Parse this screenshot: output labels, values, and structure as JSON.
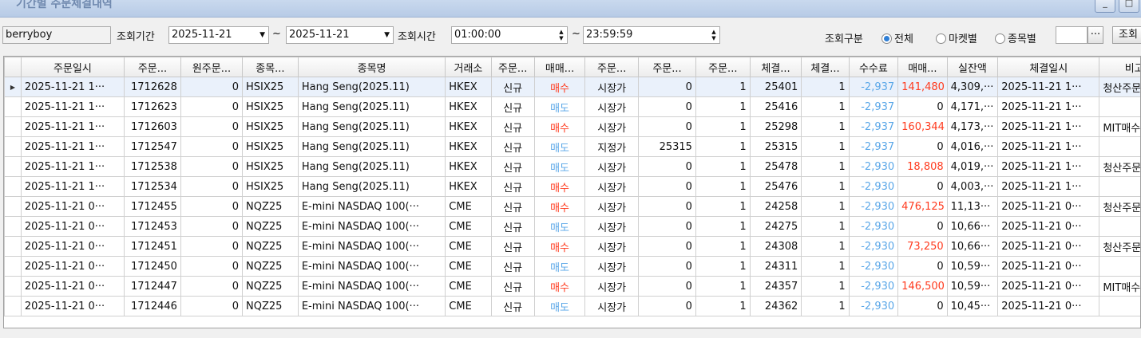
{
  "window": {
    "title": "기간별 주문체결내역",
    "minimize": "_",
    "maximize": "□"
  },
  "filters": {
    "account": "berryboy",
    "period_label": "조회기간",
    "date_from": "2025-11-21",
    "tilde1": "~",
    "date_to": "2025-11-21",
    "time_label": "조회시간",
    "time_from": "01:00:00",
    "tilde2": "~",
    "time_to": "23:59:59",
    "type_label": "조회구분",
    "radio_all": "전체",
    "radio_market": "마켓별",
    "radio_symbol": "종목별",
    "more_button": "···",
    "query_button": "조회"
  },
  "columns": [
    "주문일시",
    "주문...",
    "원주문...",
    "종목...",
    "종목명",
    "거래소",
    "주문...",
    "매매...",
    "주문...",
    "주문...",
    "주문...",
    "체결...",
    "체결...",
    "수수료",
    "매매...",
    "실잔액",
    "체결일시",
    "비고"
  ],
  "rows": [
    {
      "order_time": "2025-11-21 1···",
      "order_no": "1712628",
      "orig_no": "0",
      "code": "HSIX25",
      "name": "Hang Seng(2025.11)",
      "exch": "HKEX",
      "otype": "신규",
      "side": "매수",
      "ptype": "시장가",
      "oprice": "0",
      "oqty": "1",
      "fprice": "25401",
      "fqty": "1",
      "fee": "-2,937",
      "pnl": "141,480",
      "bal": "4,309,···",
      "ftime": "2025-11-21 1···",
      "note": "청산주문"
    },
    {
      "order_time": "2025-11-21 1···",
      "order_no": "1712623",
      "orig_no": "0",
      "code": "HSIX25",
      "name": "Hang Seng(2025.11)",
      "exch": "HKEX",
      "otype": "신규",
      "side": "매도",
      "ptype": "시장가",
      "oprice": "0",
      "oqty": "1",
      "fprice": "25416",
      "fqty": "1",
      "fee": "-2,937",
      "pnl": "0",
      "bal": "4,171,···",
      "ftime": "2025-11-21 1···",
      "note": ""
    },
    {
      "order_time": "2025-11-21 1···",
      "order_no": "1712603",
      "orig_no": "0",
      "code": "HSIX25",
      "name": "Hang Seng(2025.11)",
      "exch": "HKEX",
      "otype": "신규",
      "side": "매수",
      "ptype": "시장가",
      "oprice": "0",
      "oqty": "1",
      "fprice": "25298",
      "fqty": "1",
      "fee": "-2,937",
      "pnl": "160,344",
      "bal": "4,173,···",
      "ftime": "2025-11-21 1···",
      "note": "MIT매수"
    },
    {
      "order_time": "2025-11-21 1···",
      "order_no": "1712547",
      "orig_no": "0",
      "code": "HSIX25",
      "name": "Hang Seng(2025.11)",
      "exch": "HKEX",
      "otype": "신규",
      "side": "매도",
      "ptype": "지정가",
      "oprice": "25315",
      "oqty": "1",
      "fprice": "25315",
      "fqty": "1",
      "fee": "-2,937",
      "pnl": "0",
      "bal": "4,016,···",
      "ftime": "2025-11-21 1···",
      "note": ""
    },
    {
      "order_time": "2025-11-21 1···",
      "order_no": "1712538",
      "orig_no": "0",
      "code": "HSIX25",
      "name": "Hang Seng(2025.11)",
      "exch": "HKEX",
      "otype": "신규",
      "side": "매도",
      "ptype": "시장가",
      "oprice": "0",
      "oqty": "1",
      "fprice": "25478",
      "fqty": "1",
      "fee": "-2,930",
      "pnl": "18,808",
      "bal": "4,019,···",
      "ftime": "2025-11-21 1···",
      "note": "청산주문"
    },
    {
      "order_time": "2025-11-21 1···",
      "order_no": "1712534",
      "orig_no": "0",
      "code": "HSIX25",
      "name": "Hang Seng(2025.11)",
      "exch": "HKEX",
      "otype": "신규",
      "side": "매수",
      "ptype": "시장가",
      "oprice": "0",
      "oqty": "1",
      "fprice": "25476",
      "fqty": "1",
      "fee": "-2,930",
      "pnl": "0",
      "bal": "4,003,···",
      "ftime": "2025-11-21 1···",
      "note": ""
    },
    {
      "order_time": "2025-11-21 0···",
      "order_no": "1712455",
      "orig_no": "0",
      "code": "NQZ25",
      "name": "E-mini NASDAQ 100(···",
      "exch": "CME",
      "otype": "신규",
      "side": "매수",
      "ptype": "시장가",
      "oprice": "0",
      "oqty": "1",
      "fprice": "24258",
      "fqty": "1",
      "fee": "-2,930",
      "pnl": "476,125",
      "bal": "11,13···",
      "ftime": "2025-11-21 0···",
      "note": "청산주문"
    },
    {
      "order_time": "2025-11-21 0···",
      "order_no": "1712453",
      "orig_no": "0",
      "code": "NQZ25",
      "name": "E-mini NASDAQ 100(···",
      "exch": "CME",
      "otype": "신규",
      "side": "매도",
      "ptype": "시장가",
      "oprice": "0",
      "oqty": "1",
      "fprice": "24275",
      "fqty": "1",
      "fee": "-2,930",
      "pnl": "0",
      "bal": "10,66···",
      "ftime": "2025-11-21 0···",
      "note": ""
    },
    {
      "order_time": "2025-11-21 0···",
      "order_no": "1712451",
      "orig_no": "0",
      "code": "NQZ25",
      "name": "E-mini NASDAQ 100(···",
      "exch": "CME",
      "otype": "신규",
      "side": "매수",
      "ptype": "시장가",
      "oprice": "0",
      "oqty": "1",
      "fprice": "24308",
      "fqty": "1",
      "fee": "-2,930",
      "pnl": "73,250",
      "bal": "10,66···",
      "ftime": "2025-11-21 0···",
      "note": "청산주문"
    },
    {
      "order_time": "2025-11-21 0···",
      "order_no": "1712450",
      "orig_no": "0",
      "code": "NQZ25",
      "name": "E-mini NASDAQ 100(···",
      "exch": "CME",
      "otype": "신규",
      "side": "매도",
      "ptype": "시장가",
      "oprice": "0",
      "oqty": "1",
      "fprice": "24311",
      "fqty": "1",
      "fee": "-2,930",
      "pnl": "0",
      "bal": "10,59···",
      "ftime": "2025-11-21 0···",
      "note": ""
    },
    {
      "order_time": "2025-11-21 0···",
      "order_no": "1712447",
      "orig_no": "0",
      "code": "NQZ25",
      "name": "E-mini NASDAQ 100(···",
      "exch": "CME",
      "otype": "신규",
      "side": "매수",
      "ptype": "시장가",
      "oprice": "0",
      "oqty": "1",
      "fprice": "24357",
      "fqty": "1",
      "fee": "-2,930",
      "pnl": "146,500",
      "bal": "10,59···",
      "ftime": "2025-11-21 0···",
      "note": "MIT매수"
    },
    {
      "order_time": "2025-11-21 0···",
      "order_no": "1712446",
      "orig_no": "0",
      "code": "NQZ25",
      "name": "E-mini NASDAQ 100(···",
      "exch": "CME",
      "otype": "신규",
      "side": "매도",
      "ptype": "시장가",
      "oprice": "0",
      "oqty": "1",
      "fprice": "24362",
      "fqty": "1",
      "fee": "-2,930",
      "pnl": "0",
      "bal": "10,45···",
      "ftime": "2025-11-21 0···",
      "note": ""
    }
  ],
  "colors": {
    "buy": "#ff3b1f",
    "sell": "#5aa7e8",
    "fee": "#5aa7e8",
    "profit": "#ff3b1f"
  },
  "icons": {
    "row_indicator": "triangle-right-icon",
    "radio_selected": "radio-on-icon"
  }
}
